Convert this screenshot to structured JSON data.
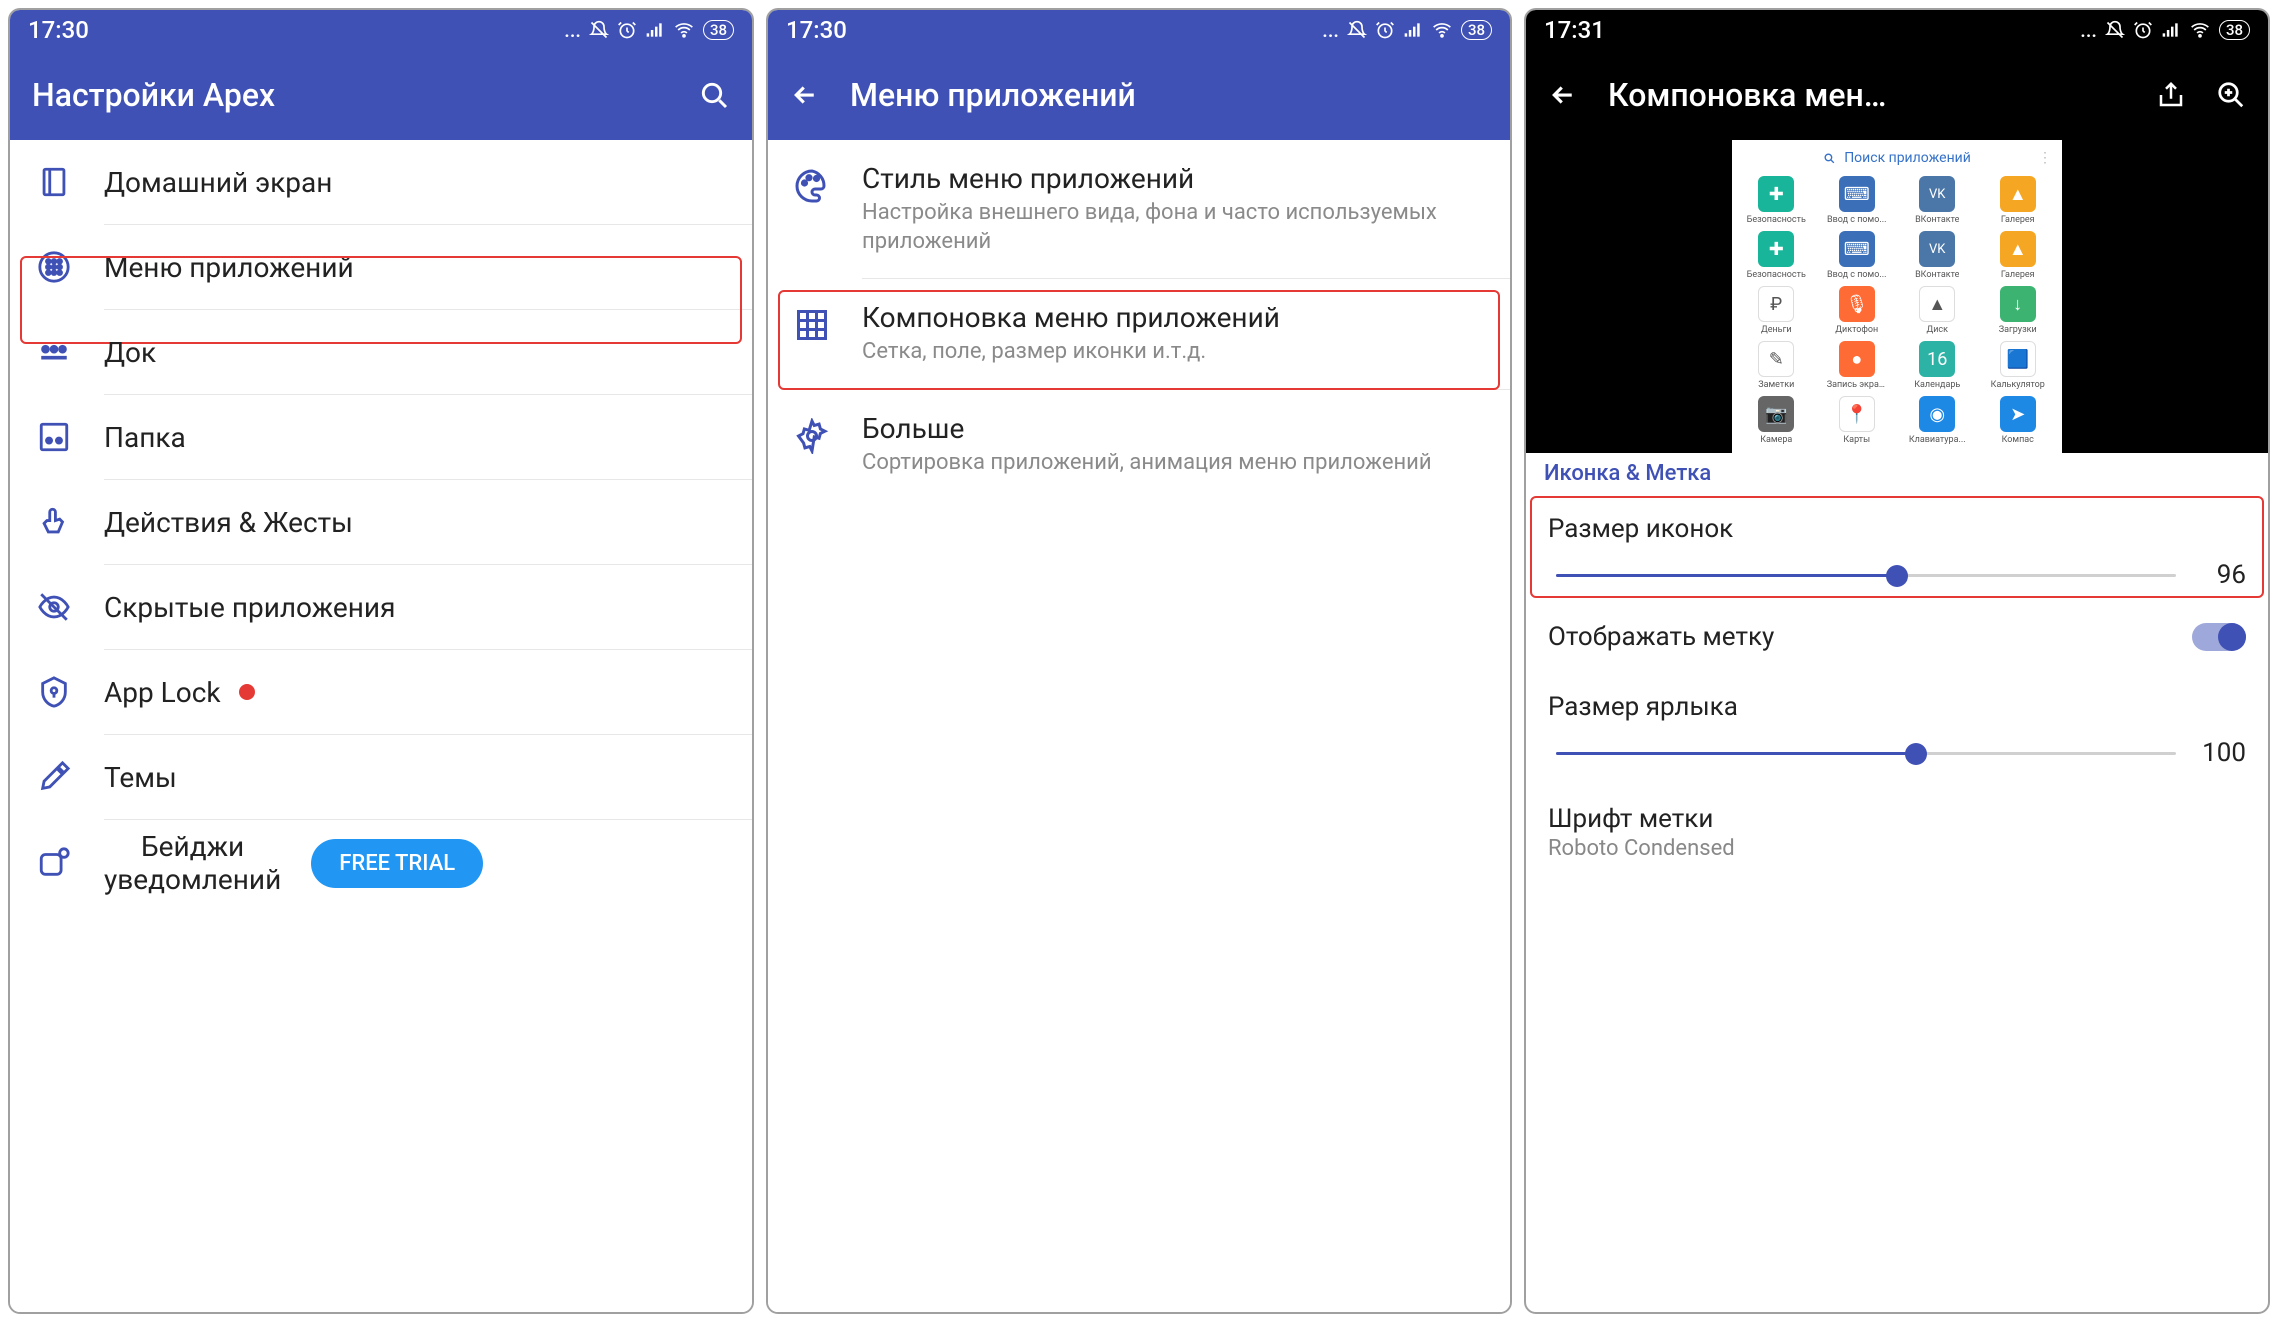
{
  "status": {
    "time1": "17:30",
    "time2": "17:30",
    "time3": "17:31",
    "battery": "38"
  },
  "screen1": {
    "title": "Настройки Apex",
    "items": [
      {
        "label": "Домашний экран"
      },
      {
        "label": "Меню приложений"
      },
      {
        "label": "Док"
      },
      {
        "label": "Папка"
      },
      {
        "label": "Действия & Жесты"
      },
      {
        "label": "Скрытые приложения"
      },
      {
        "label": "App Lock"
      },
      {
        "label": "Темы"
      }
    ],
    "cutoff_label": "Бейджи\nуведомлений",
    "free_trial": "FREE TRIAL"
  },
  "screen2": {
    "title": "Меню приложений",
    "items": [
      {
        "title": "Стиль меню приложений",
        "sub": "Настройка внешнего вида, фона и часто используемых приложений"
      },
      {
        "title": "Компоновка меню приложений",
        "sub": "Сетка, поле, размер иконки и.т.д."
      },
      {
        "title": "Больше",
        "sub": "Сортировка приложений, анимация меню приложений"
      }
    ]
  },
  "screen3": {
    "title": "Компоновка мен…",
    "search_placeholder": "Поиск приложений",
    "apps": [
      {
        "label": "Безопасность",
        "color": "#18b59a",
        "glyph": "✚"
      },
      {
        "label": "Ввод с помо...",
        "color": "#3b6fb8",
        "glyph": "⌨"
      },
      {
        "label": "ВКонтакте",
        "color": "#4a76a8",
        "glyph": "VK"
      },
      {
        "label": "Галерея",
        "color": "#f5a623",
        "glyph": "▲"
      },
      {
        "label": "Безопасность",
        "color": "#18b59a",
        "glyph": "✚"
      },
      {
        "label": "Ввод с помо...",
        "color": "#3b6fb8",
        "glyph": "⌨"
      },
      {
        "label": "ВКонтакте",
        "color": "#4a76a8",
        "glyph": "VK"
      },
      {
        "label": "Галерея",
        "color": "#f5a623",
        "glyph": "▲"
      },
      {
        "label": "Деньги",
        "color": "#ffffff",
        "glyph": "₽"
      },
      {
        "label": "Диктофон",
        "color": "#ff6b35",
        "glyph": "🎙"
      },
      {
        "label": "Диск",
        "color": "#ffffff",
        "glyph": "▲"
      },
      {
        "label": "Загрузки",
        "color": "#3cb371",
        "glyph": "↓"
      },
      {
        "label": "Заметки",
        "color": "#ffffff",
        "glyph": "✎"
      },
      {
        "label": "Запись экрана",
        "color": "#ff6b35",
        "glyph": "●"
      },
      {
        "label": "Календарь",
        "color": "#2db3a5",
        "glyph": "16"
      },
      {
        "label": "Калькулятор",
        "color": "#ffffff",
        "glyph": "🟦"
      },
      {
        "label": "Камера",
        "color": "#666666",
        "glyph": "📷"
      },
      {
        "label": "Карты",
        "color": "#ffffff",
        "glyph": "📍"
      },
      {
        "label": "Клавиатура...",
        "color": "#1e88e5",
        "glyph": "◉"
      },
      {
        "label": "Компас",
        "color": "#1e88e5",
        "glyph": "➤"
      }
    ],
    "section_header": "Иконка & Метка",
    "icon_size": {
      "label": "Размер иконок",
      "value": 96,
      "pct": 55
    },
    "show_label": {
      "label": "Отображать метку",
      "on": true
    },
    "label_size": {
      "label": "Размер ярлыка",
      "value": 100,
      "pct": 58
    },
    "font_row": {
      "label": "Шрифт метки",
      "value": "Roboto Condensed"
    }
  }
}
